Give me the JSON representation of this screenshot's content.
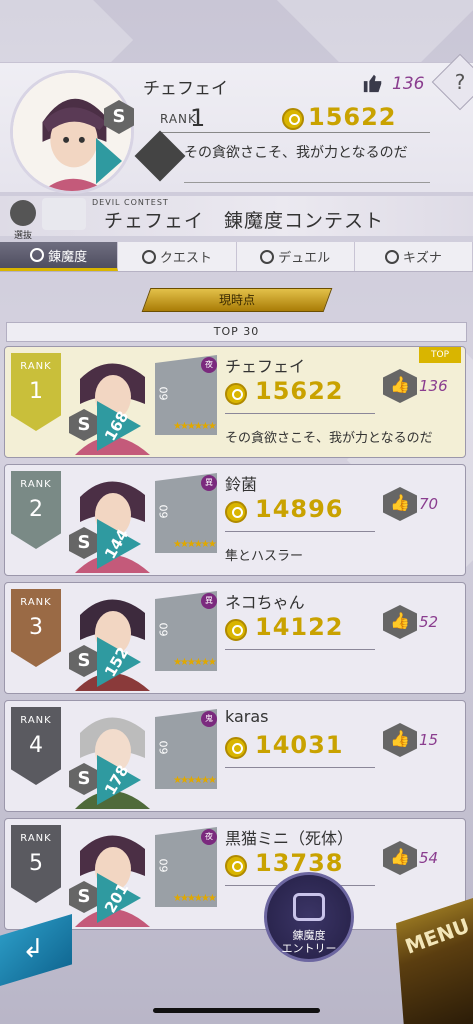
{
  "header": {
    "player_name": "チェフェイ",
    "likes": "136",
    "rank_label": "RANK",
    "rank": "1",
    "score": "15622",
    "quote": "その貪欲さこそ、我が力となるのだ",
    "help_label": "?"
  },
  "contest": {
    "small_label": "DEVIL CONTEST",
    "title": "チェフェイ　錬魔度コンテスト",
    "icon_label": "選抜"
  },
  "tabs": [
    {
      "label": "錬魔度",
      "active": true
    },
    {
      "label": "クエスト",
      "active": false
    },
    {
      "label": "デュエル",
      "active": false
    },
    {
      "label": "キズナ",
      "active": false
    }
  ],
  "current_button_label": "現時点",
  "top_label": "TOP 30",
  "rankings": [
    {
      "rank_label": "RANK",
      "rank": "1",
      "name": "チェフェイ",
      "score": "15622",
      "message": "その貪欲さこそ、我が力となるのだ",
      "likes": "136",
      "plv": "168",
      "pet_lv": "60",
      "pet_rank_char": "夜",
      "badge_color": "#c9bf3a",
      "new_tag": "TOP"
    },
    {
      "rank_label": "RANK",
      "rank": "2",
      "name": "鈴菌",
      "score": "14896",
      "message": "隼とハスラー",
      "likes": "70",
      "plv": "144",
      "pet_lv": "60",
      "pet_rank_char": "異",
      "badge_color": "#7a8a86"
    },
    {
      "rank_label": "RANK",
      "rank": "3",
      "name": "ネコちゃん",
      "score": "14122",
      "message": "",
      "likes": "52",
      "plv": "152",
      "pet_lv": "60",
      "pet_rank_char": "異",
      "badge_color": "#9a6a45"
    },
    {
      "rank_label": "RANK",
      "rank": "4",
      "name": "karas",
      "score": "14031",
      "message": "",
      "likes": "15",
      "plv": "178",
      "pet_lv": "60",
      "pet_rank_char": "鬼",
      "badge_color": "#5a5a60"
    },
    {
      "rank_label": "RANK",
      "rank": "5",
      "name": "黒猫ミニ（死体）",
      "score": "13738",
      "message": "",
      "likes": "54",
      "plv": "201",
      "pet_lv": "60",
      "pet_rank_char": "夜",
      "badge_color": "#5a5a60"
    }
  ],
  "entry_button": {
    "line1": "錬魔度",
    "line2": "エントリー"
  },
  "menu_label": "MENU",
  "colors": {
    "gold": "#c9a200",
    "purple": "#8a3d8f",
    "teal": "#2f9aa0"
  }
}
